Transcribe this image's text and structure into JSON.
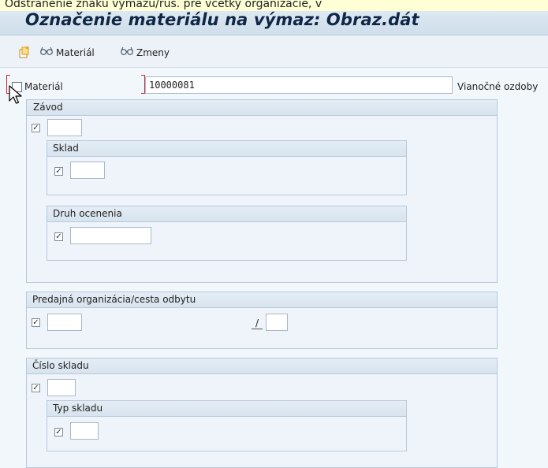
{
  "top_strip_text": "Odstránenie znaku výmazu/ruš. pre vcetky organizácie, v",
  "title": "Označenie materiálu na výmaz: Obraz.dát",
  "toolbar": {
    "items": [
      {
        "label": "",
        "icon": "create-document-icon"
      },
      {
        "label": "Materiál",
        "icon": "glasses-icon"
      },
      {
        "label": "Zmeny",
        "icon": "glasses-icon"
      }
    ]
  },
  "material": {
    "label": "Materiál",
    "value": "10000081",
    "description": "Vianočné ozdoby"
  },
  "zavod": {
    "title": "Závod",
    "value": "",
    "sklad": {
      "title": "Sklad",
      "value": ""
    },
    "druh_ocenenia": {
      "title": "Druh ocenenia",
      "value": ""
    }
  },
  "predajna": {
    "title": "Predajná organizácia/cesta odbytu",
    "separator": "/",
    "value1": "",
    "value2": ""
  },
  "cislo_skladu": {
    "title": "Číslo skladu",
    "value": "",
    "typ_skladu": {
      "title": "Typ skladu",
      "value": ""
    }
  },
  "checkmark": "✓",
  "colors": {
    "accent_title": "#0f2645",
    "focus_red": "#dd2233",
    "group_border": "#b9c9d9"
  }
}
